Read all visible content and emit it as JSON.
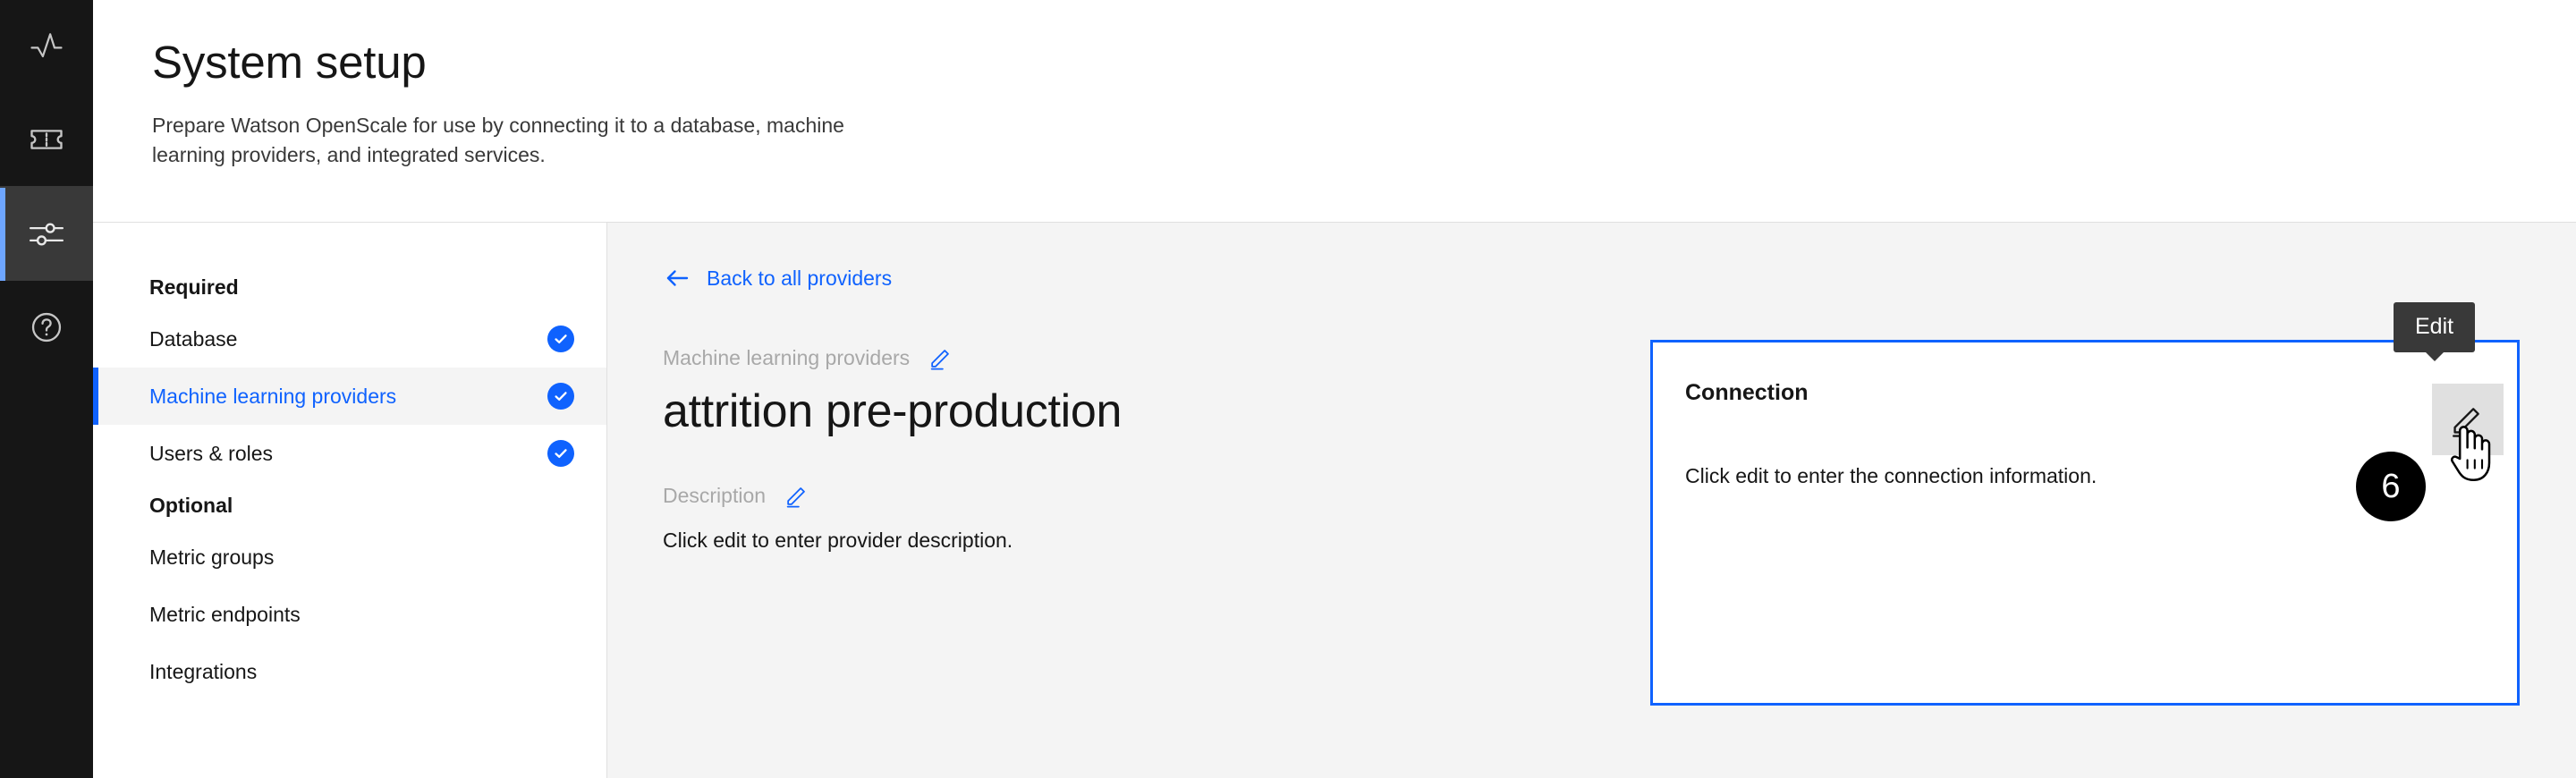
{
  "rail": {
    "items": [
      {
        "name": "insights",
        "icon": "pulse-icon"
      },
      {
        "name": "tickets",
        "icon": "ticket-icon"
      },
      {
        "name": "settings",
        "icon": "sliders-icon",
        "active": true
      },
      {
        "name": "help",
        "icon": "question-circle-icon"
      }
    ]
  },
  "header": {
    "title": "System setup",
    "subtitle": "Prepare Watson OpenScale for use by connecting it to a database, machine learning providers, and integrated services."
  },
  "nav": {
    "groups": [
      {
        "label": "Required",
        "items": [
          {
            "label": "Database",
            "complete": true,
            "selected": false
          },
          {
            "label": "Machine learning providers",
            "complete": true,
            "selected": true
          },
          {
            "label": "Users & roles",
            "complete": true,
            "selected": false
          }
        ]
      },
      {
        "label": "Optional",
        "items": [
          {
            "label": "Metric groups",
            "complete": false,
            "selected": false
          },
          {
            "label": "Metric endpoints",
            "complete": false,
            "selected": false
          },
          {
            "label": "Integrations",
            "complete": false,
            "selected": false
          }
        ]
      }
    ]
  },
  "main": {
    "back_label": "Back to all providers",
    "provider_type_label": "Machine learning providers",
    "provider_name": "attrition pre-production",
    "description_label": "Description",
    "description_value": "Click edit to enter provider description."
  },
  "connection": {
    "title": "Connection",
    "text": "Click edit to enter the connection information.",
    "tooltip": "Edit",
    "step_number": "6"
  },
  "colors": {
    "accent_blue": "#0f62fe",
    "rail_bg": "#161616",
    "rail_active_bg": "#393939",
    "rail_active_bar": "#6ea6ff",
    "panel_bg": "#f4f4f4",
    "muted_text": "#a8a8a8",
    "tooltip_bg": "#393939",
    "badge_bg": "#000000"
  }
}
